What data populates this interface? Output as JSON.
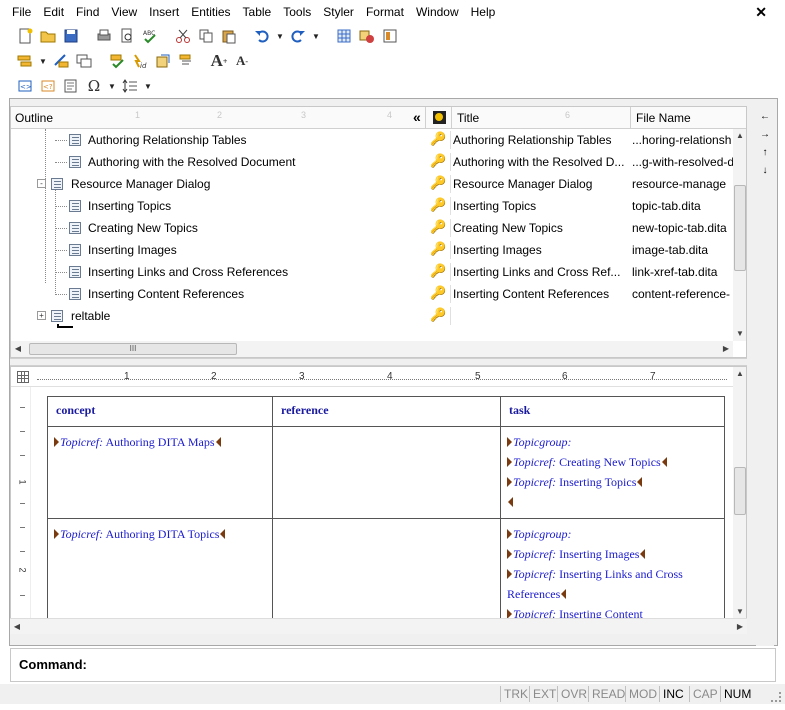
{
  "menubar": {
    "items": [
      "File",
      "Edit",
      "Find",
      "View",
      "Insert",
      "Entities",
      "Table",
      "Tools",
      "Styler",
      "Format",
      "Window",
      "Help"
    ],
    "close": "✕"
  },
  "outline": {
    "headers": {
      "outline": "Outline",
      "collapse": "«",
      "title": "Title",
      "file": "File Name"
    },
    "rows": [
      {
        "label": "Authoring Relationship Tables",
        "title": "Authoring Relationship Tables",
        "file": "...horing-relationsh"
      },
      {
        "label": "Authoring with the Resolved Document",
        "title": "Authoring with the Resolved D...",
        "file": "...g-with-resolved-d"
      },
      {
        "label": "Resource Manager Dialog",
        "title": "Resource Manager Dialog",
        "file": "resource-manage"
      },
      {
        "label": "Inserting Topics",
        "title": "Inserting Topics",
        "file": "topic-tab.dita"
      },
      {
        "label": "Creating New Topics",
        "title": "Creating New Topics",
        "file": "new-topic-tab.dita"
      },
      {
        "label": "Inserting Images",
        "title": "Inserting Images",
        "file": "image-tab.dita"
      },
      {
        "label": "Inserting Links and Cross References",
        "title": "Inserting Links and Cross Ref...",
        "file": "link-xref-tab.dita"
      },
      {
        "label": "Inserting Content References",
        "title": "Inserting Content References",
        "file": "content-reference-"
      },
      {
        "label": "reltable",
        "title": "",
        "file": ""
      }
    ],
    "hscroll_grip": "III"
  },
  "ruler": {
    "numbers": [
      "1",
      "2",
      "3",
      "4",
      "5",
      "6",
      "7"
    ],
    "vnumbers": [
      "1",
      "2"
    ]
  },
  "reltable": {
    "headers": [
      "concept",
      "reference",
      "task"
    ],
    "topicref_kw": "Topicref:",
    "topicgroup_kw": "Topicgroup:",
    "row1": {
      "concept": "Authoring DITA Maps",
      "task": [
        "Creating New Topics",
        "Inserting Topics"
      ]
    },
    "row2": {
      "concept": "Authoring DITA Topics",
      "task": [
        "Inserting Images",
        "Inserting Links and Cross References",
        "Inserting Content"
      ]
    }
  },
  "command": {
    "label": "Command:",
    "value": ""
  },
  "status": {
    "indicators": [
      {
        "label": "TRK",
        "on": false
      },
      {
        "label": "EXT",
        "on": false
      },
      {
        "label": "OVR",
        "on": false
      },
      {
        "label": "READ",
        "on": false
      },
      {
        "label": "MOD",
        "on": false
      },
      {
        "label": "INC",
        "on": true
      },
      {
        "label": "CAP",
        "on": false
      },
      {
        "label": "NUM",
        "on": true
      }
    ]
  }
}
